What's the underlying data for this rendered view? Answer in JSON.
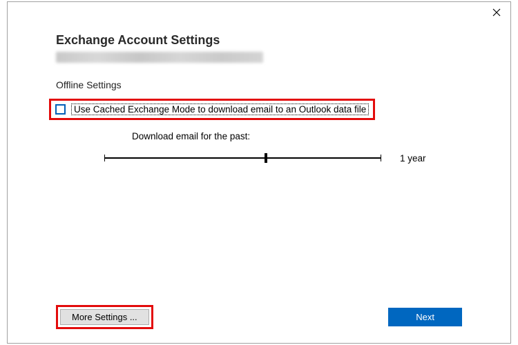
{
  "header": {
    "title": "Exchange Account Settings"
  },
  "offline": {
    "section_label": "Offline Settings",
    "cached_mode_label": "Use Cached Exchange Mode to download email to an Outlook data file",
    "download_past_label": "Download email for the past:",
    "slider_value": "1 year"
  },
  "footer": {
    "more_settings_label": "More Settings ...",
    "next_label": "Next"
  }
}
